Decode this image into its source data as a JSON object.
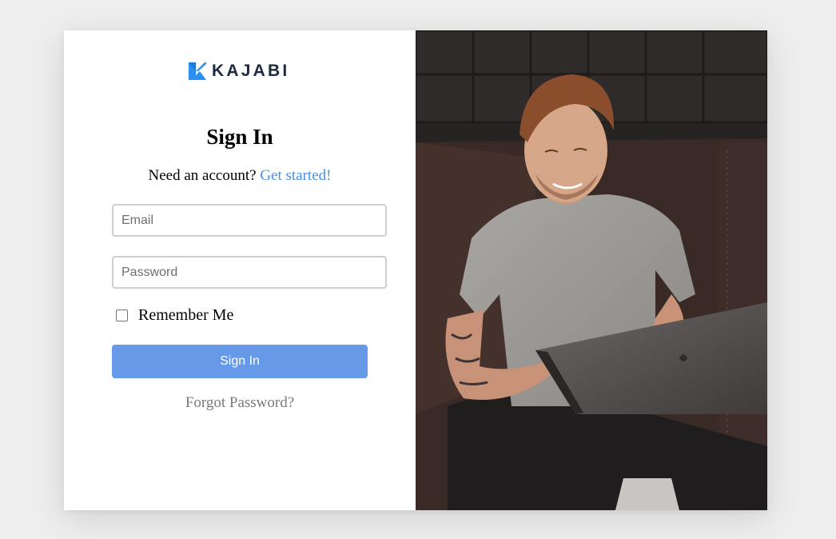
{
  "brand": {
    "name": "KAJABI",
    "logo_icon": "kajabi-k-icon",
    "logo_color": "#2b8ef0",
    "text_color": "#1b2a3d"
  },
  "signin": {
    "title": "Sign In",
    "need_account_text": "Need an account?",
    "get_started_link": "Get started!",
    "link_color": "#4a90e2",
    "email_placeholder": "Email",
    "email_value": "",
    "password_placeholder": "Password",
    "password_value": "",
    "remember_label": "Remember Me",
    "remember_checked": false,
    "submit_label": "Sign In",
    "button_color": "#6699e8",
    "forgot_link": "Forgot Password?"
  },
  "hero": {
    "subject": "man-with-laptop-photo"
  }
}
